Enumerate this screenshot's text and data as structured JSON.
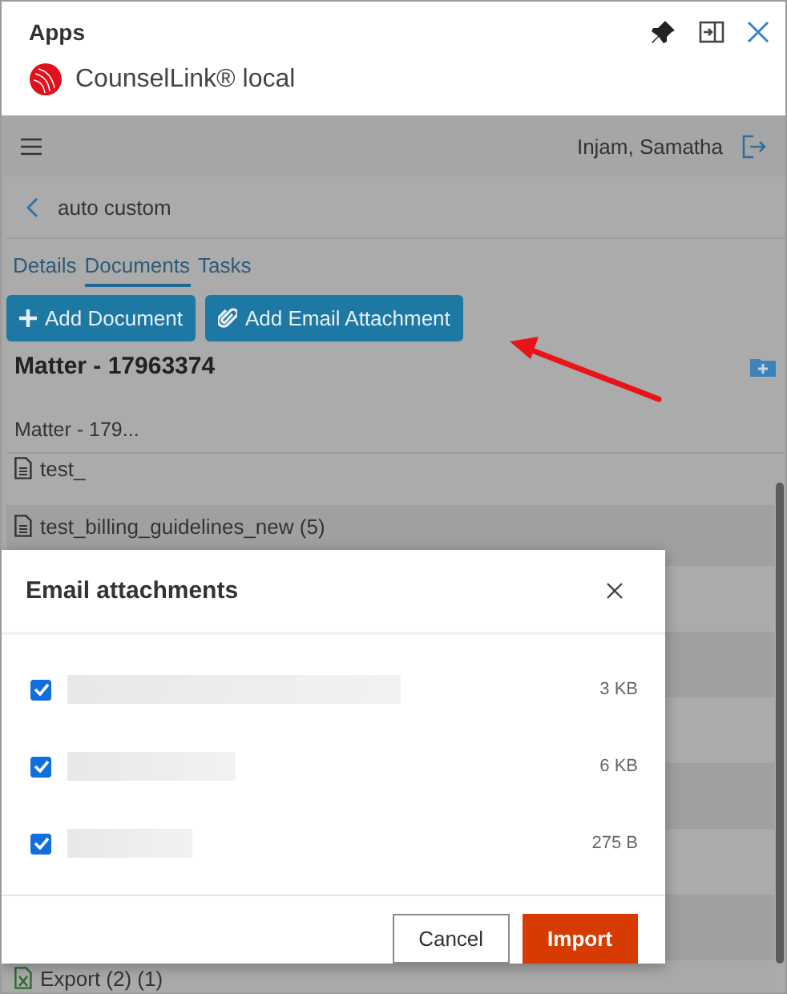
{
  "window": {
    "title": "Apps",
    "app_name": "CounselLink® local"
  },
  "user": {
    "name": "Injam, Samatha"
  },
  "breadcrumb": {
    "label": "auto custom"
  },
  "tabs": [
    {
      "label": "Details",
      "selected": false
    },
    {
      "label": "Documents",
      "selected": true
    },
    {
      "label": "Tasks",
      "selected": false
    }
  ],
  "actions": [
    {
      "kind": "add",
      "label": "Add Document"
    },
    {
      "kind": "attach",
      "label": "Add Email Attachment"
    }
  ],
  "matter": {
    "title": "Matter - 17963374",
    "folder": "Matter - 179..."
  },
  "documents": [
    {
      "kind": "doc",
      "name": "test_"
    },
    {
      "kind": "doc",
      "name": "test_billing_guidelines_new (5)"
    },
    {
      "kind": "sheet",
      "name": "Export (2) (1)"
    }
  ],
  "dialog": {
    "title": "Email attachments",
    "attachments": [
      {
        "checked": true,
        "size": "3 KB"
      },
      {
        "checked": true,
        "size": "6 KB"
      },
      {
        "checked": true,
        "size": "275 B"
      }
    ],
    "buttons": [
      {
        "kind": "secondary",
        "label": "Cancel"
      },
      {
        "kind": "primary",
        "label": "Import"
      }
    ]
  }
}
